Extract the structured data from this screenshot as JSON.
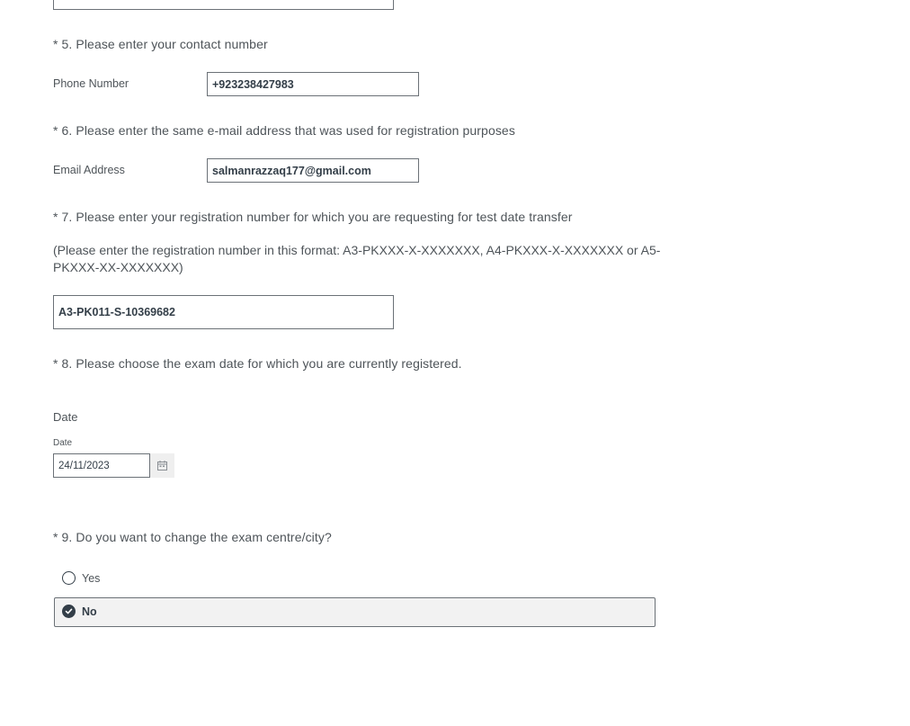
{
  "q5": {
    "question": "* 5. Please enter your contact number",
    "label": "Phone Number",
    "value": "+923238427983"
  },
  "q6": {
    "question": "* 6. Please enter the same e-mail address that was used for registration purposes",
    "label": "Email Address",
    "value": "salmanrazzaq177@gmail.com"
  },
  "q7": {
    "question": "* 7. Please enter your registration number for which you are requesting for test date transfer",
    "note": "(Please enter the registration number in this format: A3-PKXXX-X-XXXXXXX, A4-PKXXX-X-XXXXXXX or A5-PKXXX-XX-XXXXXXX)",
    "value": "A3-PK011-S-10369682"
  },
  "q8": {
    "question": "* 8. Please choose the exam date for which you are currently registered.",
    "group_label": "Date",
    "field_label": "Date",
    "value": "24/11/2023",
    "calendar_icon": "calendar-icon"
  },
  "q9": {
    "question": "* 9. Do you want to change the exam centre/city?",
    "options": [
      {
        "label": "Yes",
        "selected": false
      },
      {
        "label": "No",
        "selected": true
      }
    ]
  },
  "colors": {
    "text": "#333e48",
    "muted_text": "#4e5459",
    "border": "#6b7177",
    "selected_bg": "#f2f2f2"
  }
}
